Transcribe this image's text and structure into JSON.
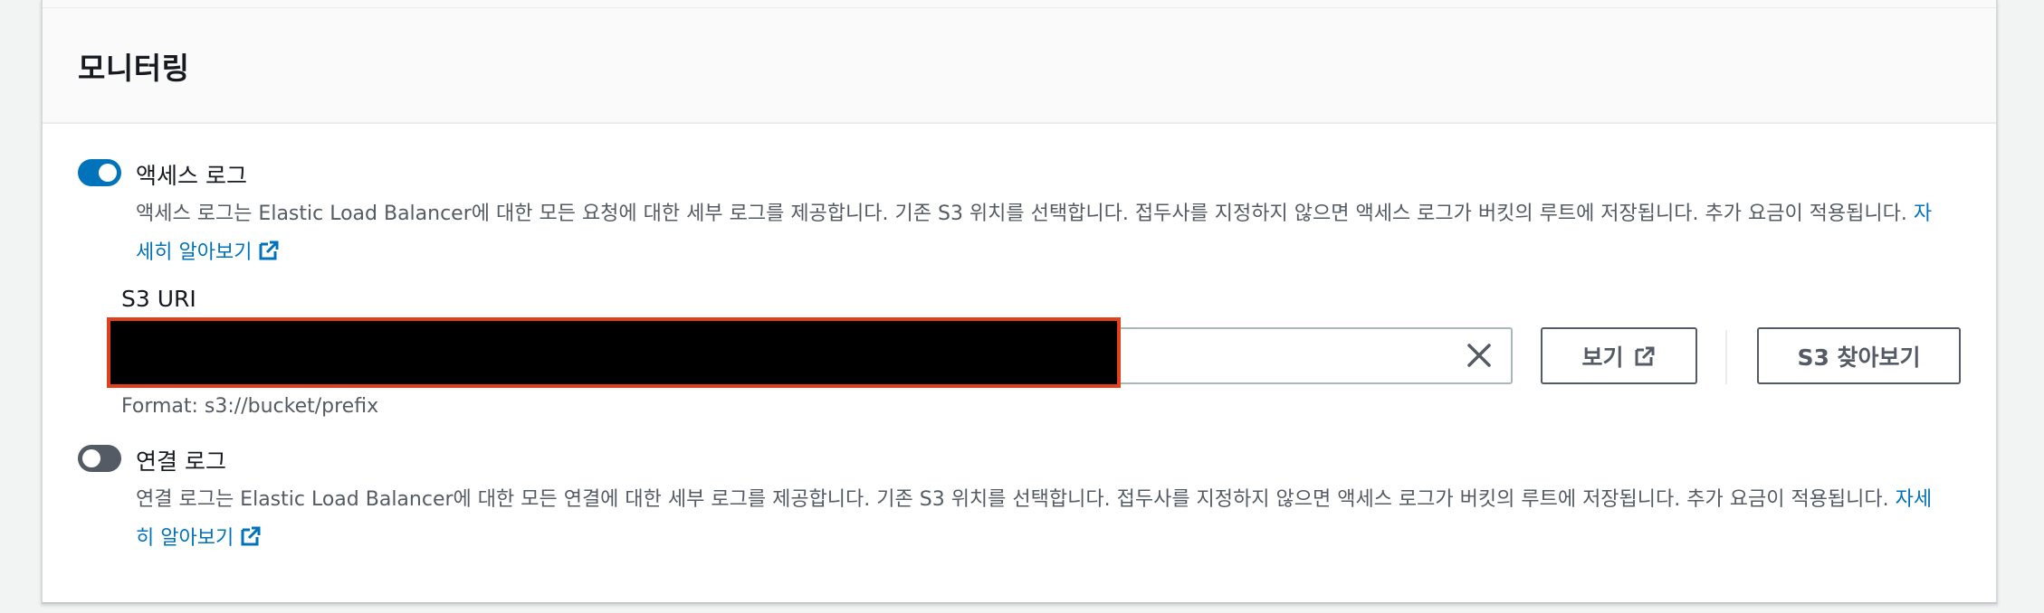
{
  "section": {
    "title": "모니터링"
  },
  "access_logs": {
    "enabled": true,
    "label": "액세스 로그",
    "description_line1": "액세스 로그는 Elastic Load Balancer에 대한 모든 요청에 대한 세부 로그를 제공합니다. 기존 S3 위치를 선택합니다. 접두사를 지정하지 않으면 액세스 로그가 버킷의 루트에 저장됩니다. 추가 요금이 적용됩니다.",
    "learn_more_line1": "자",
    "learn_more_line2": "세히 알아보기",
    "field_label": "S3 URI",
    "input_value": "",
    "format_hint": "Format: s3://bucket/prefix",
    "view_button": "보기",
    "browse_button": "S3 찾아보기"
  },
  "connection_logs": {
    "enabled": false,
    "label": "연결 로그",
    "description_line1": "연결 로그는 Elastic Load Balancer에 대한 모든 연결에 대한 세부 로그를 제공합니다. 기존 S3 위치를 선택합니다. 접두사를 지정하지 않으면 액세스 로그가 버킷의 루트에 저장됩니다. 추가 요금이 적용됩니다.",
    "learn_more_line1": "자세",
    "learn_more_line2": "히 알아보기"
  },
  "icons": {
    "external_link": "external-link-icon",
    "clear": "close-icon"
  },
  "colors": {
    "toggle_on": "#0073bb",
    "toggle_off": "#545b64",
    "link": "#0073bb",
    "redaction_border": "#e0401b"
  }
}
